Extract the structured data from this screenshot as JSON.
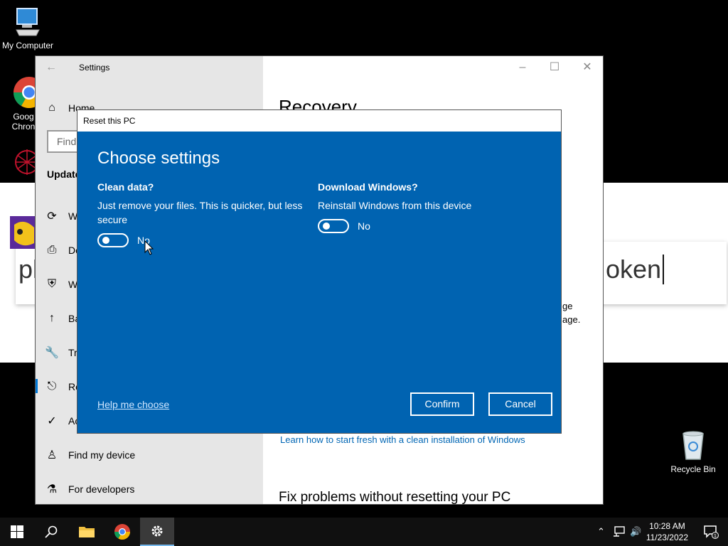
{
  "desktop": {
    "icons": [
      {
        "label": "My Computer"
      },
      {
        "label": "Goog\nChron"
      },
      {
        "label": "Recycle Bin"
      }
    ]
  },
  "background_app": {
    "search_text_left": "pl",
    "search_text_right": "oken"
  },
  "settings": {
    "title": "Settings",
    "home": "Home",
    "find_placeholder": "Find",
    "section_heading": "Update",
    "nav": [
      {
        "icon": "sync-icon",
        "label": "W"
      },
      {
        "icon": "delivery-icon",
        "label": "De"
      },
      {
        "icon": "shield-icon",
        "label": "W"
      },
      {
        "icon": "backup-icon",
        "label": "Ba"
      },
      {
        "icon": "wrench-icon",
        "label": "Tr"
      },
      {
        "icon": "recovery-icon",
        "label": "Re"
      },
      {
        "icon": "activation-icon",
        "label": "Ac"
      },
      {
        "icon": "person-icon",
        "label": "Find my device"
      },
      {
        "icon": "developer-icon",
        "label": "For developers"
      }
    ],
    "main_title": "Recovery",
    "frag1": "ge",
    "frag2": "age.",
    "learn_link": "Learn how to start fresh with a clean installation of Windows",
    "fix_heading": "Fix problems without resetting your PC"
  },
  "dialog": {
    "title": "Reset this PC",
    "heading": "Choose settings",
    "clean": {
      "question": "Clean data?",
      "desc": "Just remove your files. This is quicker, but less secure",
      "state": "No"
    },
    "download": {
      "question": "Download Windows?",
      "desc": "Reinstall Windows from this device",
      "state": "No"
    },
    "help_link": "Help me choose",
    "confirm": "Confirm",
    "cancel": "Cancel"
  },
  "taskbar": {
    "time": "10:28 AM",
    "date": "11/23/2022",
    "notif_count": "1"
  }
}
